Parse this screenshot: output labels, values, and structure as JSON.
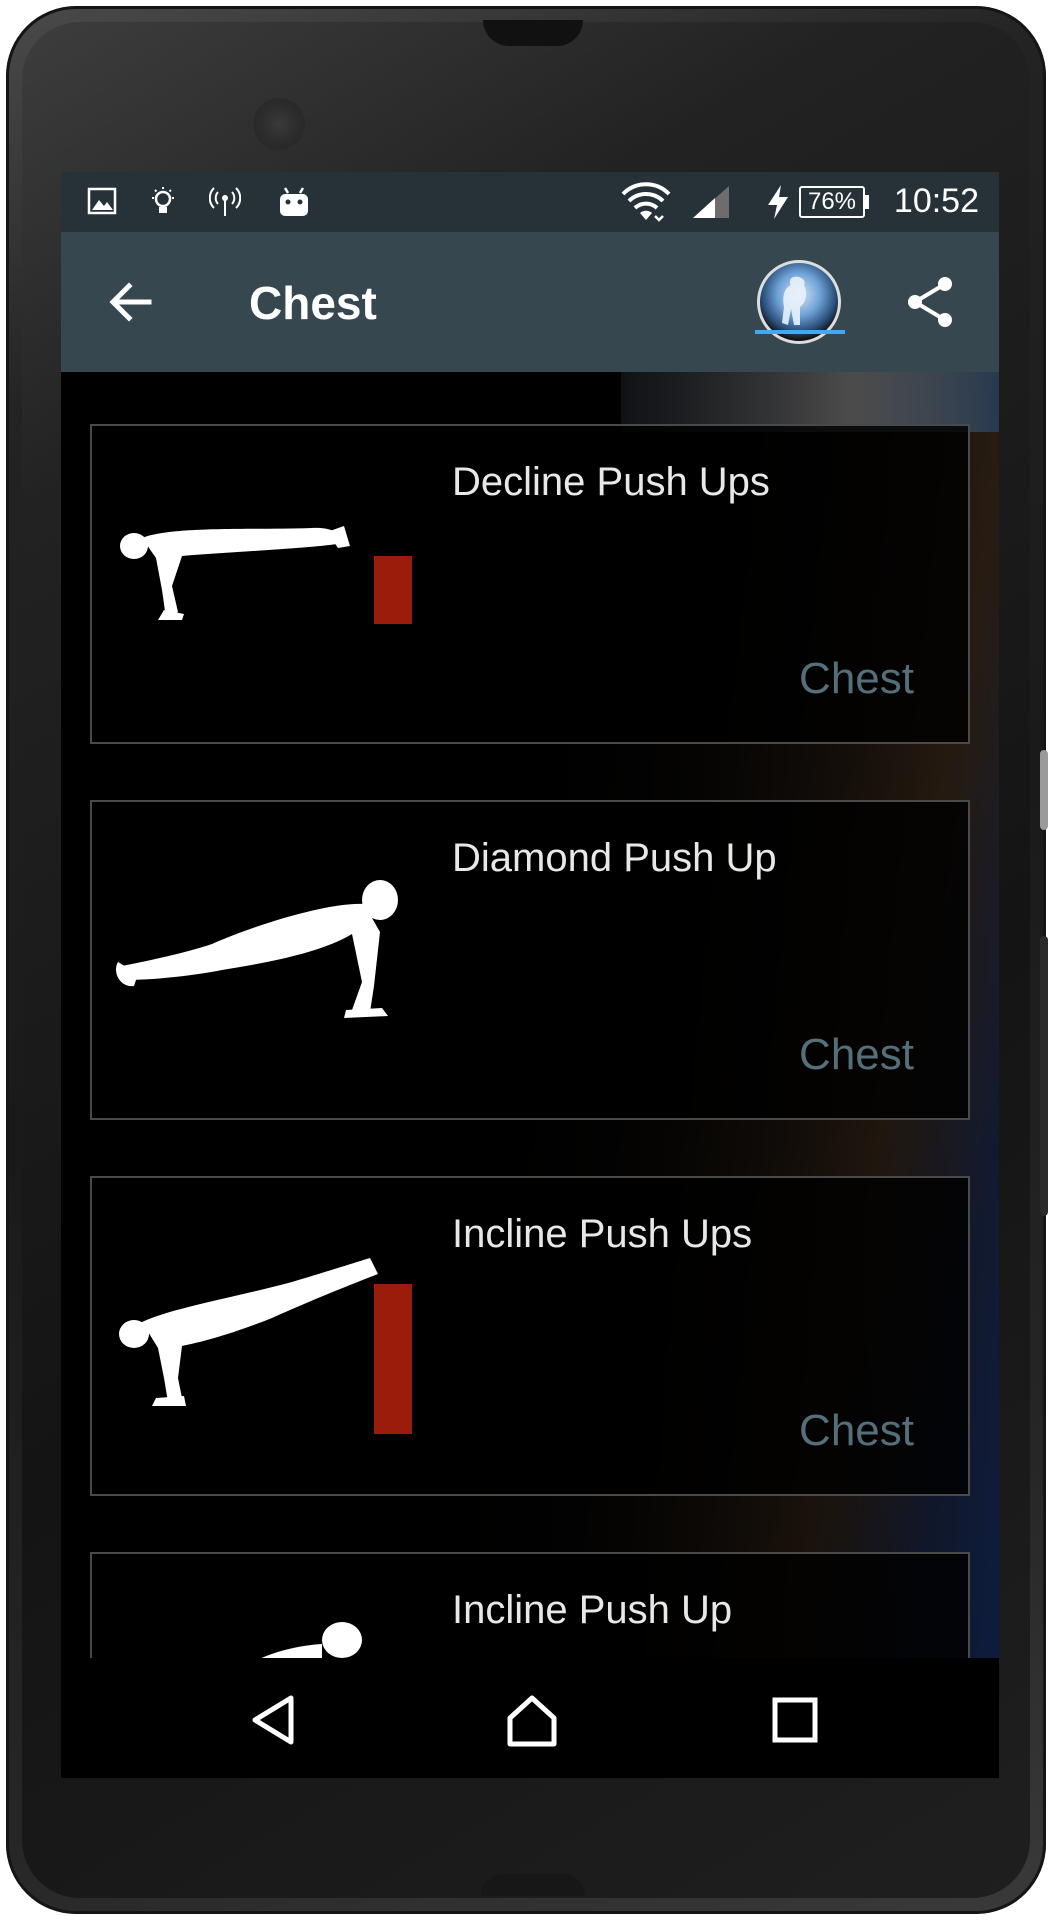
{
  "status_bar": {
    "battery": "76%",
    "time": "10:52"
  },
  "app_bar": {
    "title": "Chest"
  },
  "exercises": [
    {
      "name": "Decline Push Ups",
      "category": "Chest"
    },
    {
      "name": "Diamond Push Up",
      "category": "Chest"
    },
    {
      "name": "Incline Push Ups",
      "category": "Chest"
    },
    {
      "name": "Incline Push Up",
      "category": ""
    }
  ],
  "colors": {
    "status_bar_bg": "#263238",
    "app_bar_bg": "#37474f",
    "category_text": "#546e7a",
    "box_red": "#9b1c0a"
  },
  "icons": {
    "status": [
      "image-icon",
      "lightbulb-icon",
      "hotspot-icon",
      "android-icon",
      "wifi-icon",
      "signal-icon",
      "charging-icon"
    ],
    "app_bar": [
      "back-arrow-icon",
      "app-logo",
      "share-icon"
    ],
    "nav": [
      "back-triangle-icon",
      "home-icon",
      "recents-icon"
    ]
  }
}
